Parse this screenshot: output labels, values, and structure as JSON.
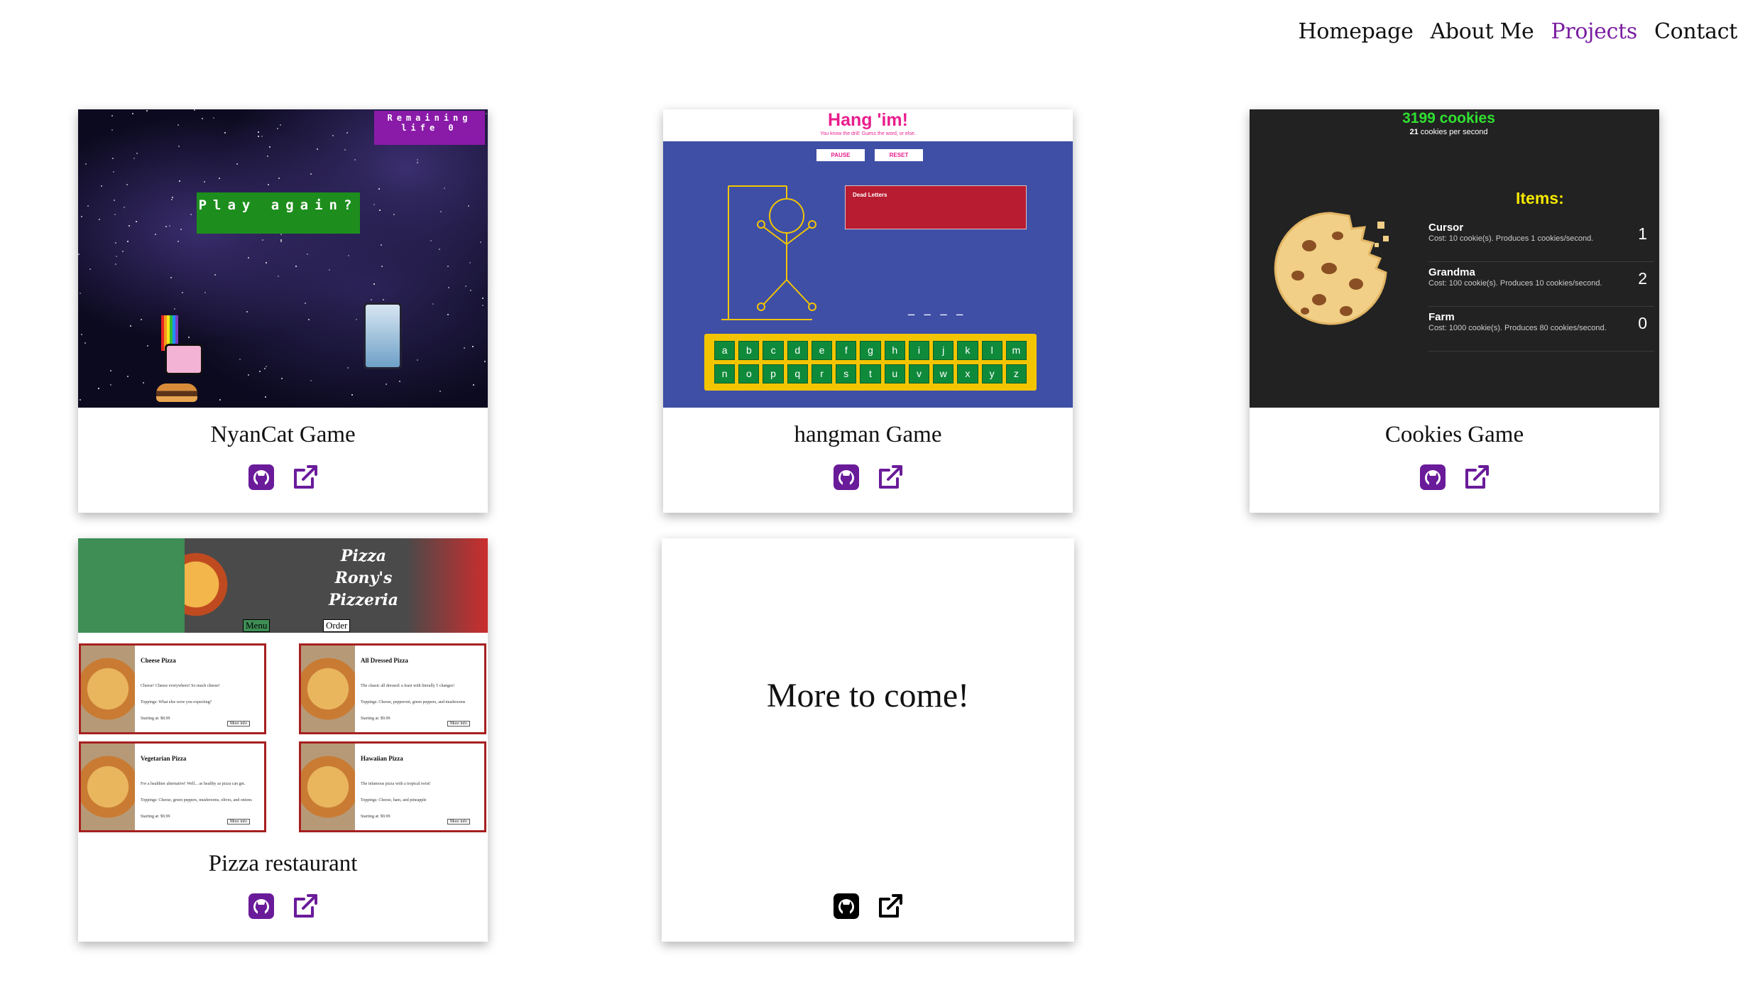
{
  "nav": {
    "items": [
      "Homepage",
      "About Me",
      "Projects",
      "Contact"
    ],
    "active": "Projects"
  },
  "colors": {
    "accent": "#7a1ea1",
    "icon_purple": "#6a1b9a"
  },
  "projects": [
    {
      "title": "NyanCat Game",
      "thumb": {
        "life_text": "Remaining life 0",
        "play_text": "Play again?"
      }
    },
    {
      "title": "hangman Game",
      "thumb": {
        "heading": "Hang 'im!",
        "subheading": "You know the drill: Guess the word, or else.",
        "pause": "PAUSE",
        "reset": "RESET",
        "dead_letters": "Dead Letters",
        "blanks": "_ _ _ _",
        "keys": [
          "a",
          "b",
          "c",
          "d",
          "e",
          "f",
          "g",
          "h",
          "i",
          "j",
          "k",
          "l",
          "m",
          "n",
          "o",
          "p",
          "q",
          "r",
          "s",
          "t",
          "u",
          "v",
          "w",
          "x",
          "y",
          "z"
        ]
      }
    },
    {
      "title": "Cookies Game",
      "thumb": {
        "count": "3199 cookies",
        "rate_num": "21",
        "rate_text": "cookies per second",
        "items_heading": "Items:",
        "items": [
          {
            "name": "Cursor",
            "desc": "Cost: 10 cookie(s). Produces 1 cookies/second.",
            "qty": "1"
          },
          {
            "name": "Grandma",
            "desc": "Cost: 100 cookie(s). Produces 10 cookies/second.",
            "qty": "2"
          },
          {
            "name": "Farm",
            "desc": "Cost: 1000 cookie(s). Produces 80 cookies/second.",
            "qty": "0"
          }
        ]
      }
    },
    {
      "title": "Pizza restaurant",
      "thumb": {
        "banner_title": [
          "Pizza",
          "Rony's",
          "Pizzeria"
        ],
        "menu": "Menu",
        "order": "Order",
        "items": [
          {
            "name": "Cheese Pizza",
            "lines": [
              "Cheese! Cheese everywhere! So much cheese!",
              "Toppings: What else were you expecting?",
              "Starting at: $8.99"
            ],
            "more": "More info"
          },
          {
            "name": "All Dressed Pizza",
            "lines": [
              "The classic all dressed: a feast with literally 5 changes!",
              "Toppings: Cheese, pepperoni, green peppers, and mushrooms",
              "Starting at: $9.99"
            ],
            "more": "More info"
          },
          {
            "name": "Vegetarian Pizza",
            "lines": [
              "For a healthier alternative! Well... as healthy as pizza can get.",
              "Toppings: Cheese, green peppers, mushrooms, olives, and onions",
              "Starting at: $9.99"
            ],
            "more": "More info"
          },
          {
            "name": "Hawaiian Pizza",
            "lines": [
              "The infamous pizza with a tropical twist!",
              "Toppings: Cheese, ham, and pineapple",
              "Starting at: $9.99"
            ],
            "more": "More info"
          }
        ]
      }
    },
    {
      "title": "More to come!"
    }
  ],
  "icons": {
    "github": "github-icon",
    "external": "external-link-icon"
  }
}
